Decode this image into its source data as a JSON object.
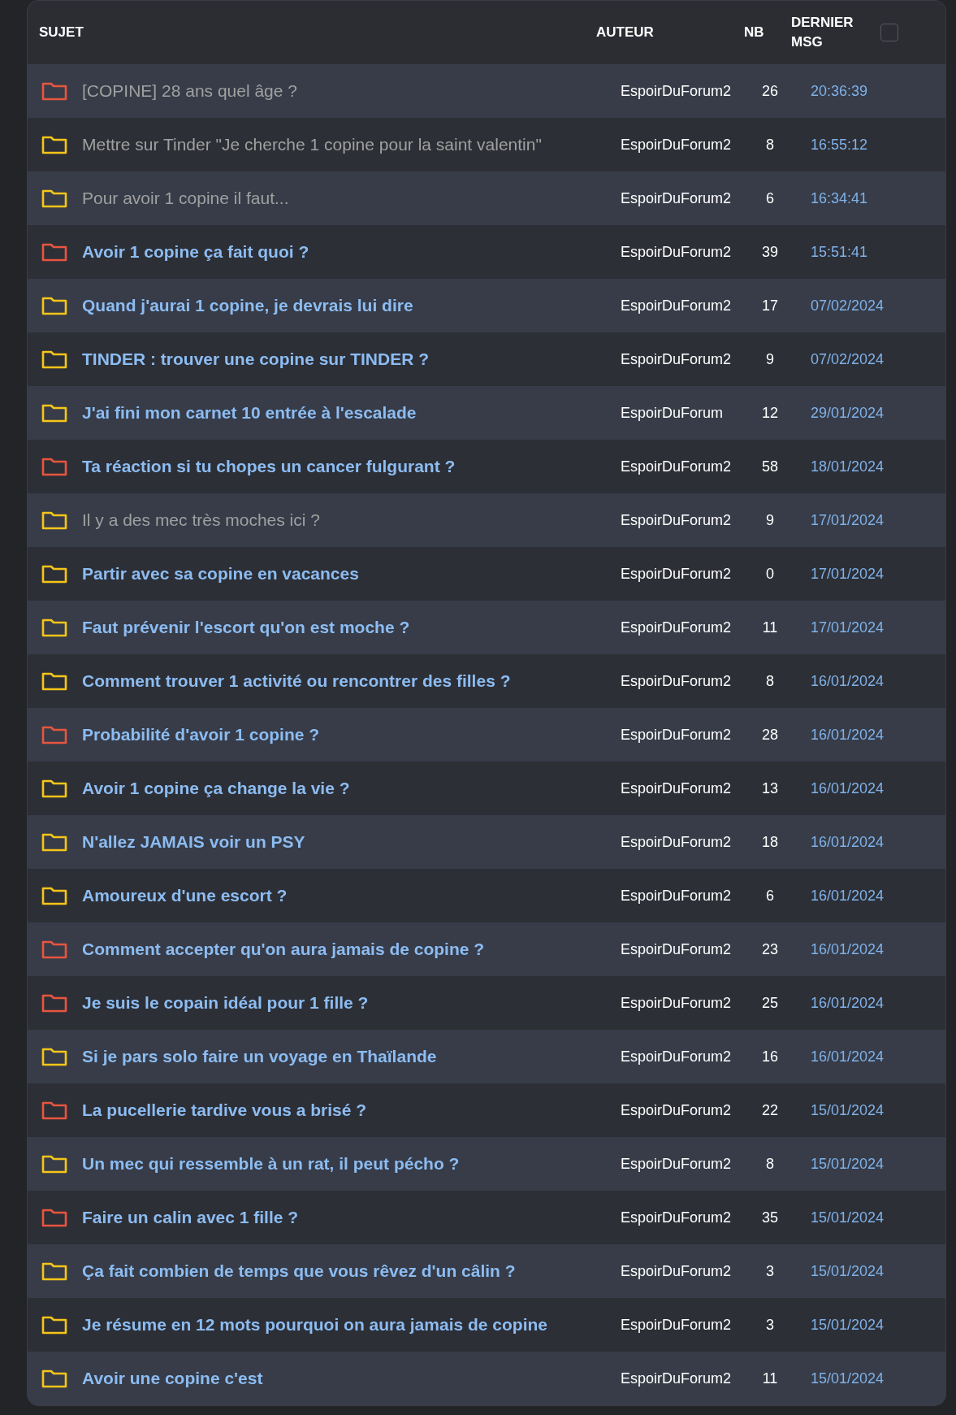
{
  "table": {
    "columns": [
      "SUJET",
      "AUTEUR",
      "NB",
      "DERNIER MSG"
    ],
    "select_all": {
      "checked": false
    },
    "rows": [
      {
        "title": "[COPINE] 28 ans quel âge ?",
        "visited": true,
        "color": "#e8553f",
        "author": "EspoirDuForum2",
        "count": "26",
        "last": "20:36:39"
      },
      {
        "title": "Mettre sur Tinder \"Je cherche 1 copine pour la saint valentin\"",
        "visited": true,
        "color": "#f5c518",
        "author": "EspoirDuForum2",
        "count": "8",
        "last": "16:55:12"
      },
      {
        "title": "Pour avoir 1 copine il faut...",
        "visited": true,
        "color": "#f5c518",
        "author": "EspoirDuForum2",
        "count": "6",
        "last": "16:34:41"
      },
      {
        "title": "Avoir 1 copine ça fait quoi ?",
        "visited": false,
        "color": "#e8553f",
        "author": "EspoirDuForum2",
        "count": "39",
        "last": "15:51:41"
      },
      {
        "title": "Quand j'aurai 1 copine, je devrais lui dire",
        "visited": false,
        "color": "#f5c518",
        "author": "EspoirDuForum2",
        "count": "17",
        "last": "07/02/2024"
      },
      {
        "title": "TINDER : trouver une copine sur TINDER ?",
        "visited": false,
        "color": "#f5c518",
        "author": "EspoirDuForum2",
        "count": "9",
        "last": "07/02/2024"
      },
      {
        "title": "J'ai fini mon carnet 10 entrée à l'escalade",
        "visited": false,
        "color": "#f5c518",
        "author": "EspoirDuForum",
        "count": "12",
        "last": "29/01/2024"
      },
      {
        "title": "Ta réaction si tu chopes un cancer fulgurant ?",
        "visited": false,
        "color": "#e8553f",
        "author": "EspoirDuForum2",
        "count": "58",
        "last": "18/01/2024"
      },
      {
        "title": "Il y a des mec très moches ici ?",
        "visited": true,
        "color": "#f5c518",
        "author": "EspoirDuForum2",
        "count": "9",
        "last": "17/01/2024"
      },
      {
        "title": "Partir avec sa copine en vacances",
        "visited": false,
        "color": "#f5c518",
        "author": "EspoirDuForum2",
        "count": "0",
        "last": "17/01/2024"
      },
      {
        "title": "Faut prévenir l'escort qu'on est moche ?",
        "visited": false,
        "color": "#f5c518",
        "author": "EspoirDuForum2",
        "count": "11",
        "last": "17/01/2024"
      },
      {
        "title": "Comment trouver 1 activité ou rencontrer des filles ?",
        "visited": false,
        "color": "#f5c518",
        "author": "EspoirDuForum2",
        "count": "8",
        "last": "16/01/2024"
      },
      {
        "title": "Probabilité d'avoir 1 copine ?",
        "visited": false,
        "color": "#e8553f",
        "author": "EspoirDuForum2",
        "count": "28",
        "last": "16/01/2024"
      },
      {
        "title": "Avoir 1 copine ça change la vie ?",
        "visited": false,
        "color": "#f5c518",
        "author": "EspoirDuForum2",
        "count": "13",
        "last": "16/01/2024"
      },
      {
        "title": "N'allez JAMAIS voir un PSY",
        "visited": false,
        "color": "#f5c518",
        "author": "EspoirDuForum2",
        "count": "18",
        "last": "16/01/2024"
      },
      {
        "title": "Amoureux d'une escort ?",
        "visited": false,
        "color": "#f5c518",
        "author": "EspoirDuForum2",
        "count": "6",
        "last": "16/01/2024"
      },
      {
        "title": "Comment accepter qu'on aura jamais de copine ?",
        "visited": false,
        "color": "#e8553f",
        "author": "EspoirDuForum2",
        "count": "23",
        "last": "16/01/2024"
      },
      {
        "title": "Je suis le copain idéal pour 1 fille ?",
        "visited": false,
        "color": "#e8553f",
        "author": "EspoirDuForum2",
        "count": "25",
        "last": "16/01/2024"
      },
      {
        "title": "Si je pars solo faire un voyage en Thaïlande",
        "visited": false,
        "color": "#f5c518",
        "author": "EspoirDuForum2",
        "count": "16",
        "last": "16/01/2024"
      },
      {
        "title": "La pucellerie tardive vous a brisé ?",
        "visited": false,
        "color": "#e8553f",
        "author": "EspoirDuForum2",
        "count": "22",
        "last": "15/01/2024"
      },
      {
        "title": "Un mec qui ressemble à un rat, il peut pécho ?",
        "visited": false,
        "color": "#f5c518",
        "author": "EspoirDuForum2",
        "count": "8",
        "last": "15/01/2024"
      },
      {
        "title": "Faire un calin avec 1 fille ?",
        "visited": false,
        "color": "#e8553f",
        "author": "EspoirDuForum2",
        "count": "35",
        "last": "15/01/2024"
      },
      {
        "title": "Ça fait combien de temps que vous rêvez d'un câlin ?",
        "visited": false,
        "color": "#f5c518",
        "author": "EspoirDuForum2",
        "count": "3",
        "last": "15/01/2024"
      },
      {
        "title": "Je résume en 12 mots pourquoi on aura jamais de copine",
        "visited": false,
        "color": "#f5c518",
        "author": "EspoirDuForum2",
        "count": "3",
        "last": "15/01/2024"
      },
      {
        "title": "Avoir une copine c'est",
        "visited": false,
        "color": "#f5c518",
        "author": "EspoirDuForum2",
        "count": "11",
        "last": "15/01/2024"
      }
    ]
  }
}
